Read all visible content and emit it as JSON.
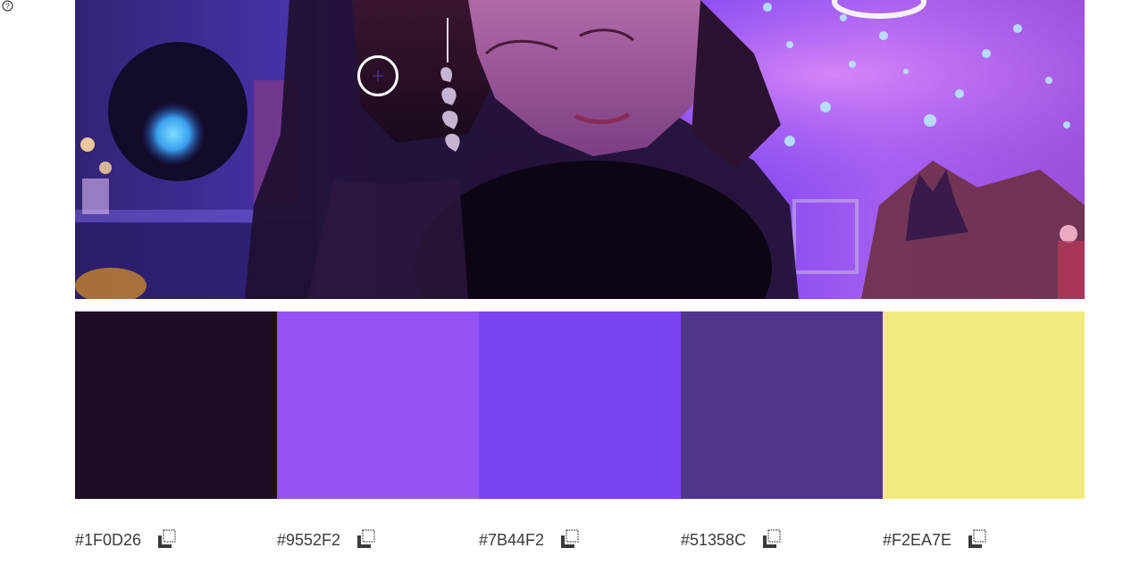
{
  "help": {
    "icon": "help-circle-icon",
    "glyph": "?"
  },
  "photo": {
    "icon": "photo-image",
    "picker_icon": "color-picker-crosshair"
  },
  "palette": {
    "swatches": [
      {
        "hex": "#1F0D26",
        "color": "#1F0D26"
      },
      {
        "hex": "#9552F2",
        "color": "#9552F2"
      },
      {
        "hex": "#7B44F2",
        "color": "#7B44F2"
      },
      {
        "hex": "#51358C",
        "color": "#51358C"
      },
      {
        "hex": "#F2EA7E",
        "color": "#F2EA7E"
      }
    ],
    "copy_icon": "copy-icon"
  }
}
